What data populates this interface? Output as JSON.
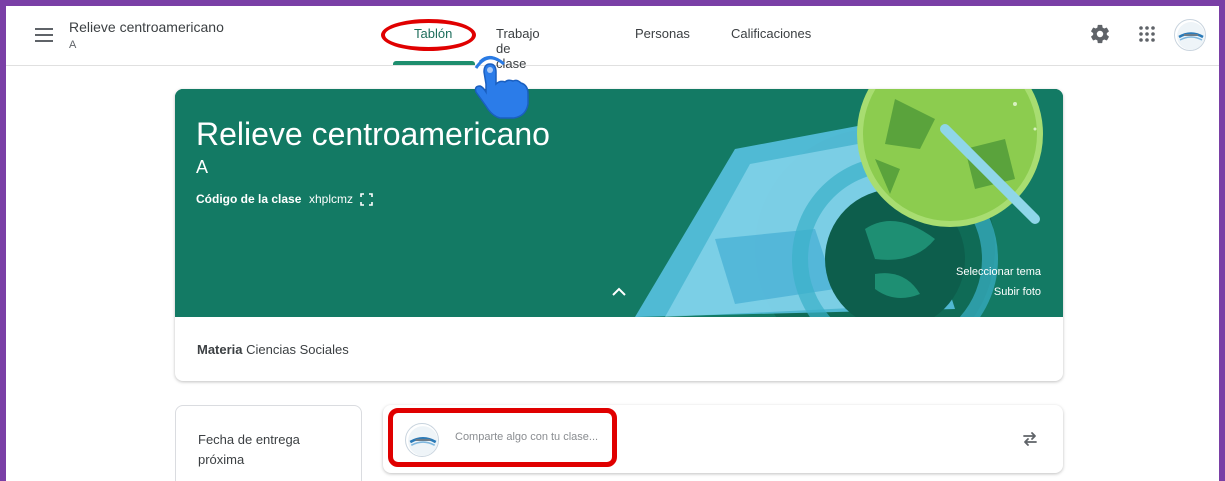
{
  "header": {
    "course_title": "Relieve centroamericano",
    "course_section": "A",
    "tabs": [
      {
        "label": "Tablón",
        "active": true
      },
      {
        "label": "Trabajo de clase",
        "active": false
      },
      {
        "label": "Personas",
        "active": false
      },
      {
        "label": "Calificaciones",
        "active": false
      }
    ],
    "icons": [
      "menu-icon",
      "gear-icon",
      "apps-icon",
      "avatar"
    ]
  },
  "banner": {
    "title": "Relieve centroamericano",
    "section": "A",
    "class_code_label": "Código de la clase",
    "class_code": "xhplcmz",
    "select_theme": "Seleccionar tema",
    "upload_photo": "Subir foto",
    "background_color": "#137a64"
  },
  "details": {
    "subject_label": "Materia",
    "subject_value": "Ciencias Sociales"
  },
  "upcoming": {
    "title": "Fecha de entrega próxima"
  },
  "stream": {
    "share_placeholder": "Comparte algo con tu clase..."
  },
  "annotations": {
    "highlight_color": "#e00000",
    "frame_color": "#7a3fa6"
  }
}
